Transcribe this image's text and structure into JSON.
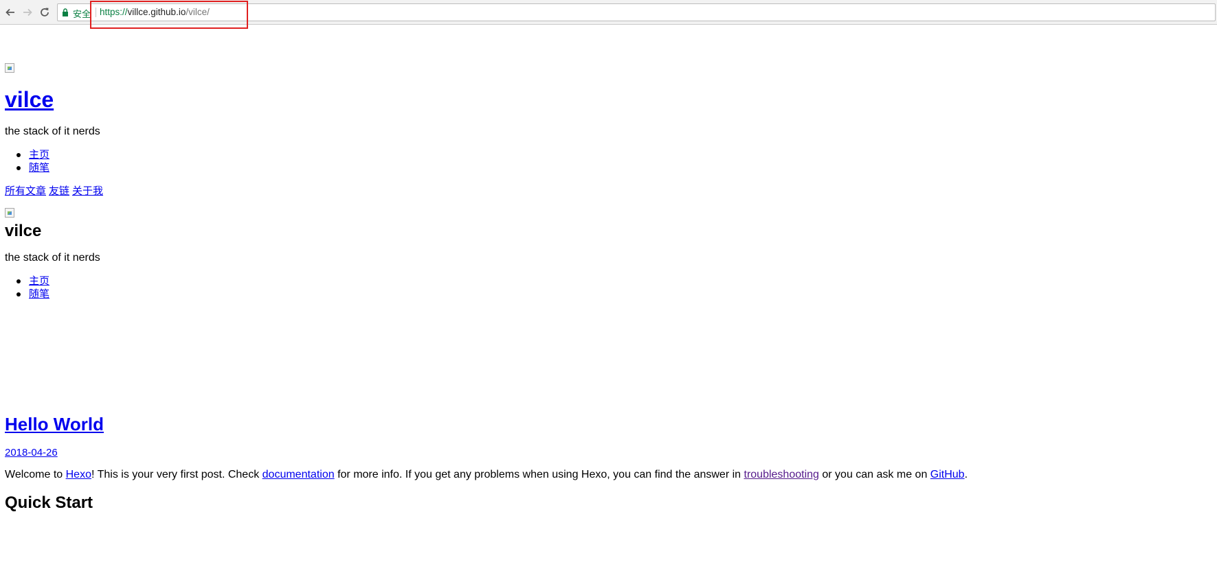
{
  "browser": {
    "secure_label": "安全",
    "url": {
      "scheme": "https://",
      "host": "villce.github.io",
      "path": "/vilce/"
    },
    "annotation_color": "#e02020"
  },
  "header": {
    "site_title": "vilce",
    "tagline": "the stack of it nerds",
    "menu": [
      "主页",
      "随笔"
    ],
    "links": [
      "所有文章",
      "友链",
      "关于我"
    ]
  },
  "sidebar": {
    "title": "vilce",
    "tagline": "the stack of it nerds",
    "menu": [
      "主页",
      "随笔"
    ]
  },
  "post": {
    "title": "Hello World",
    "date": "2018-04-26",
    "body": {
      "t1": "Welcome to ",
      "hexo": "Hexo",
      "t2": "! This is your very first post. Check ",
      "documentation": "documentation",
      "t3": " for more info. If you get any problems when using Hexo, you can find the answer in ",
      "troubleshooting": "troubleshooting",
      "t4": " or you can ask me on ",
      "github": "GitHub",
      "t5": "."
    },
    "section_heading": "Quick Start"
  },
  "colors": {
    "link": "#0000ee",
    "visited_link": "#551a8b",
    "secure_green": "#0b8043"
  }
}
